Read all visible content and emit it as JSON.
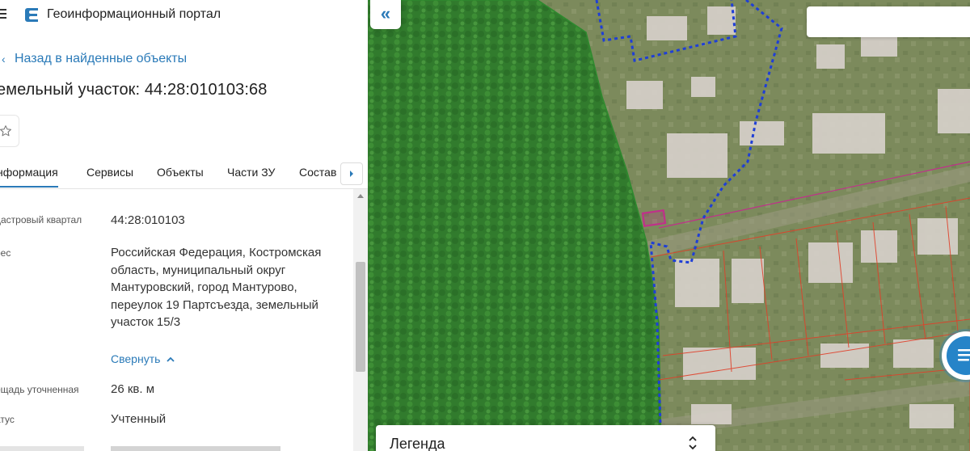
{
  "app": {
    "title": "Геоинформационный портал"
  },
  "navigation": {
    "back_label": "Назад в найденные объекты"
  },
  "object": {
    "title": "емельный участок: 44:28:010103:68"
  },
  "tabs": [
    {
      "label": "нформация",
      "active": true
    },
    {
      "label": "Сервисы"
    },
    {
      "label": "Объекты"
    },
    {
      "label": "Части ЗУ"
    },
    {
      "label": "Состав"
    }
  ],
  "properties": [
    {
      "label": "дастровый квартал",
      "value": "44:28:010103"
    },
    {
      "label": "рес",
      "value": "Российская Федерация, Костромская область, муниципальный округ Мантуровский, город Мантурово, переулок 19 Партсъезда, земельный участок 15/3"
    },
    {
      "label": "ощадь уточненная",
      "value": "26 кв. м"
    },
    {
      "label": "атус",
      "value": "Учтенный"
    }
  ],
  "collapse_label": "Свернуть",
  "map": {
    "legend_label": "Легенда"
  },
  "colors": {
    "accent": "#2a7ab8",
    "forest_zone": "#2f8a2f",
    "boundary_dotted": "#1f3fd6",
    "parcel_highlight": "#c0308a",
    "cadastral_lines": "#e0402a"
  },
  "icons": {
    "menu": "hamburger-icon",
    "logo": "portal-logo-icon",
    "back": "chevron-left-icon",
    "favorite": "star-icon",
    "tabs_next": "chevron-right-icon",
    "collapse_panel": "double-chevron-left-icon",
    "collapse_address": "chevron-up-icon",
    "chat": "chat-icon",
    "legend_toggle": "chevron-up-down-icon"
  }
}
